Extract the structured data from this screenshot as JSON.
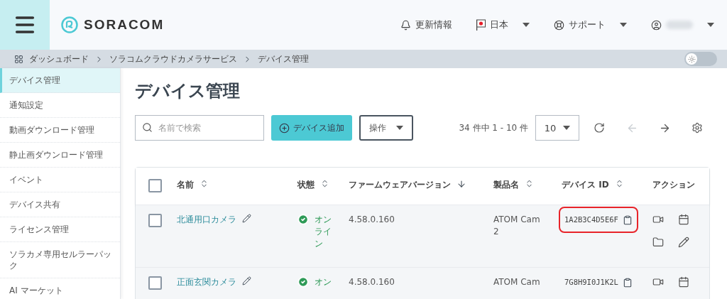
{
  "header": {
    "logo": "SORACOM",
    "nav": [
      {
        "kind": "notice",
        "label": "更新情報"
      },
      {
        "kind": "region",
        "label": "日本"
      },
      {
        "kind": "support",
        "label": "サポート"
      },
      {
        "kind": "user"
      }
    ]
  },
  "breadcrumb": [
    "ダッシュボード",
    "ソラコムクラウドカメラサービス",
    "デバイス管理"
  ],
  "theme_toggle": {
    "on": false
  },
  "sidebar": {
    "items": [
      {
        "label": "デバイス管理",
        "selected": true
      },
      {
        "label": "通知設定",
        "selected": false
      },
      {
        "label": "動画ダウンロード管理",
        "selected": false
      },
      {
        "label": "静止画ダウンロード管理",
        "selected": false
      },
      {
        "label": "イベント",
        "selected": false
      },
      {
        "label": "デバイス共有",
        "selected": false
      },
      {
        "label": "ライセンス管理",
        "selected": false
      },
      {
        "label": "ソラカメ専用セルラーパック",
        "selected": false
      },
      {
        "label": "AI マーケット",
        "selected": false
      }
    ]
  },
  "page_title": "デバイス管理",
  "toolbar": {
    "search": {
      "placeholder": "名前で検索"
    },
    "add_button": "デバイス追加",
    "actions_menu": "操作",
    "count": "34 件中 1 - 10 件",
    "page_size": "10",
    "prev_disabled": true,
    "next_disabled": false
  },
  "table": {
    "select_all": {
      "checked": false
    },
    "columns": [
      {
        "label": "名前",
        "sortable": true,
        "sorted_descending": false
      },
      {
        "label": "状態",
        "sortable": true,
        "sorted_descending": false
      },
      {
        "label": "ファームウェアバージョン",
        "sortable": true,
        "sorted_descending": true
      },
      {
        "label": "製品名",
        "sortable": true,
        "sorted_descending": false
      },
      {
        "label": "デバイス ID",
        "sortable": true,
        "sorted_descending": false
      },
      {
        "label": "アクション",
        "sortable": false
      }
    ],
    "rows": [
      {
        "checked": false,
        "name": "北通用口カメラ",
        "status": {
          "kind": "online",
          "label": "オンライン"
        },
        "firmware": "4.58.0.160",
        "product": "ATOM Cam 2",
        "device_id": {
          "value": "1A2B3C4D5E6F",
          "highlighted": true
        },
        "actions": [
          {
            "kind": "video"
          },
          {
            "kind": "calendar"
          },
          {
            "kind": "folder"
          },
          {
            "kind": "edit"
          }
        ]
      },
      {
        "checked": false,
        "name": "正面玄関カメラ",
        "status": {
          "kind": "online",
          "label": "オン"
        },
        "firmware": "4.58.0.160",
        "product": "ATOM Cam",
        "device_id": {
          "value": "7G8H9I0J1K2L",
          "highlighted": false
        },
        "actions": [
          {
            "kind": "video"
          },
          {
            "kind": "calendar"
          }
        ]
      }
    ]
  }
}
